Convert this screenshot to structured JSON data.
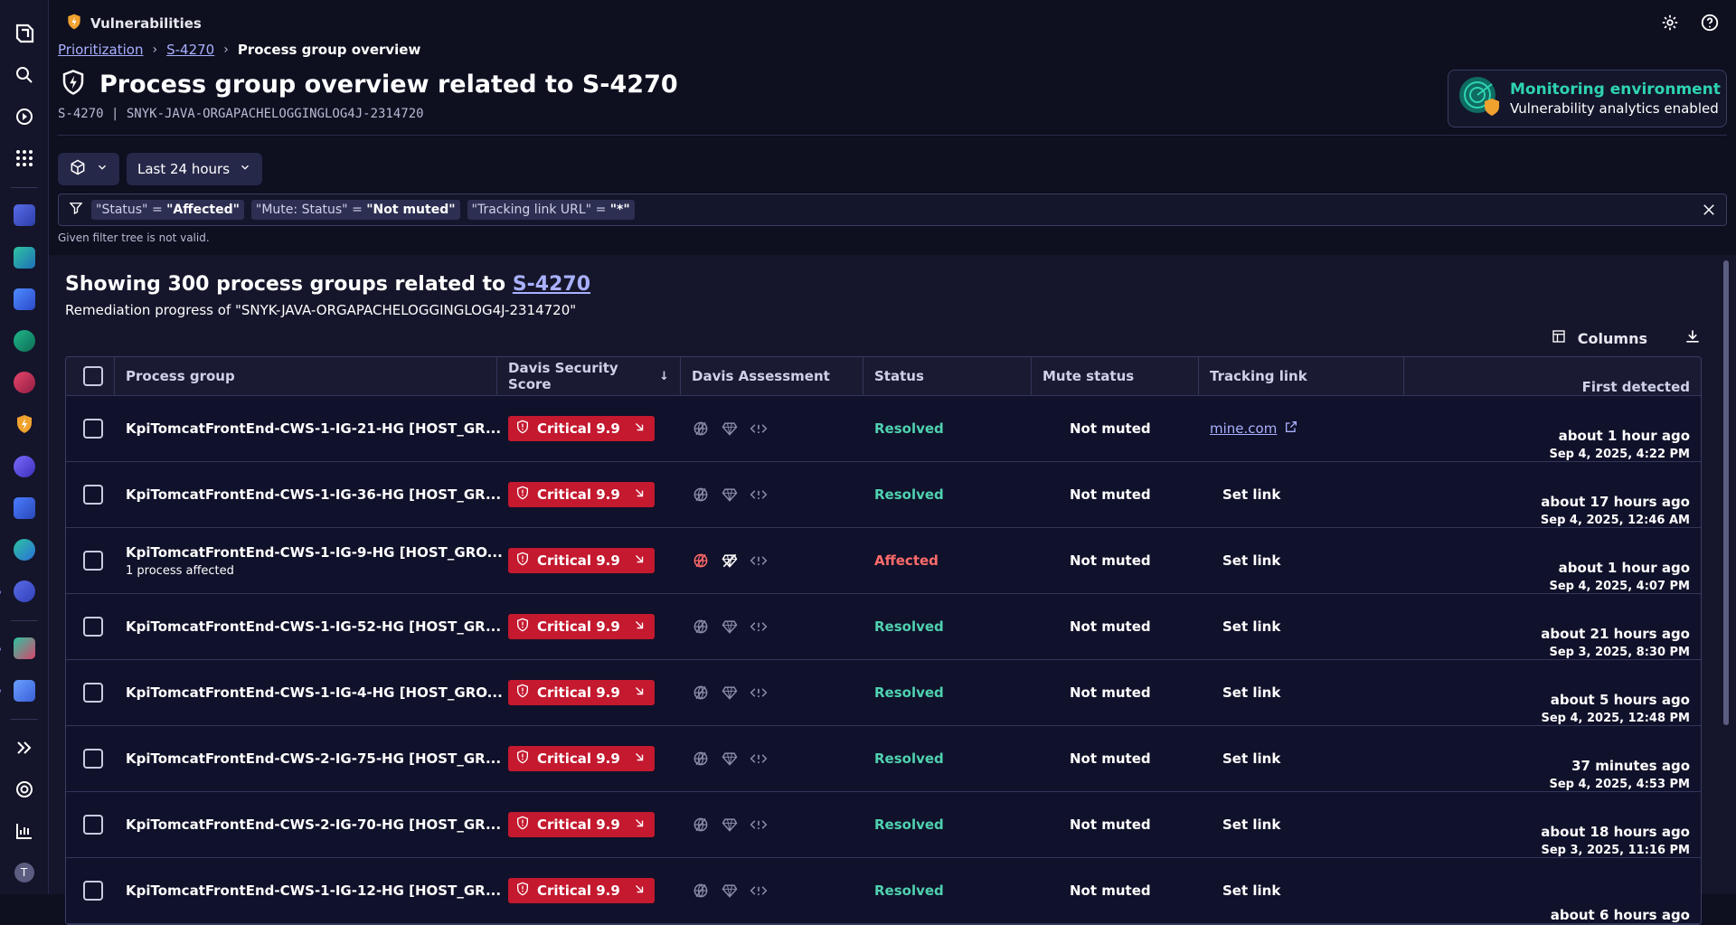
{
  "app": {
    "name": "Vulnerabilities",
    "icon": "lightning-shield-icon"
  },
  "breadcrumb": {
    "items": [
      "Prioritization",
      "S-4270"
    ],
    "current": "Process group overview"
  },
  "page": {
    "title": "Process group overview related to S-4270",
    "subtitle": "S-4270 | SNYK-JAVA-ORGAPACHELOGGINGLOG4J-2314720"
  },
  "monitor": {
    "title": "Monitoring environment",
    "subtitle": "Vulnerability analytics enabled"
  },
  "controls": {
    "timeframe": "Last 24 hours"
  },
  "filters": [
    {
      "key": "\"Status\" = ",
      "value": "\"Affected\""
    },
    {
      "key": "\"Mute: Status\" = ",
      "value": "\"Not muted\""
    },
    {
      "key": "\"Tracking link URL\" = ",
      "value": "\"*\""
    }
  ],
  "filter_error": "Given filter tree is not valid.",
  "results": {
    "showing_prefix": "Showing 300 process groups related to ",
    "showing_link": "S-4270",
    "remediation": "Remediation progress of \"SNYK-JAVA-ORGAPACHELOGGINGLOG4J-2314720\"",
    "columns_label": "Columns"
  },
  "table": {
    "headers": {
      "process_group": "Process group",
      "score": "Davis Security Score",
      "assessment": "Davis Assessment",
      "status": "Status",
      "mute": "Mute status",
      "tracking": "Tracking link",
      "first": "First detected"
    },
    "rows": [
      {
        "name": "KpiTomcatFrontEnd-CWS-1-IG-21-HG [HOST_GR...",
        "sub": "",
        "score": "Critical 9.9",
        "status": "Resolved",
        "mute": "Not muted",
        "link": "mine.com",
        "rel": "about 1 hour ago",
        "abs": "Sep 4, 2025, 4:22 PM"
      },
      {
        "name": "KpiTomcatFrontEnd-CWS-1-IG-36-HG [HOST_GR...",
        "sub": "",
        "score": "Critical 9.9",
        "status": "Resolved",
        "mute": "Not muted",
        "link": "Set link",
        "rel": "about 17 hours ago",
        "abs": "Sep 4, 2025, 12:46 AM"
      },
      {
        "name": "KpiTomcatFrontEnd-CWS-1-IG-9-HG [HOST_GRO...",
        "sub": "1 process affected",
        "score": "Critical 9.9",
        "status": "Affected",
        "mute": "Not muted",
        "link": "Set link",
        "rel": "about 1 hour ago",
        "abs": "Sep 4, 2025, 4:07 PM"
      },
      {
        "name": "KpiTomcatFrontEnd-CWS-1-IG-52-HG [HOST_GR...",
        "sub": "",
        "score": "Critical 9.9",
        "status": "Resolved",
        "mute": "Not muted",
        "link": "Set link",
        "rel": "about 21 hours ago",
        "abs": "Sep 3, 2025, 8:30 PM"
      },
      {
        "name": "KpiTomcatFrontEnd-CWS-1-IG-4-HG [HOST_GRO...",
        "sub": "",
        "score": "Critical 9.9",
        "status": "Resolved",
        "mute": "Not muted",
        "link": "Set link",
        "rel": "about 5 hours ago",
        "abs": "Sep 4, 2025, 12:48 PM"
      },
      {
        "name": "KpiTomcatFrontEnd-CWS-2-IG-75-HG [HOST_GR...",
        "sub": "",
        "score": "Critical 9.9",
        "status": "Resolved",
        "mute": "Not muted",
        "link": "Set link",
        "rel": "37 minutes ago",
        "abs": "Sep 4, 2025, 4:53 PM"
      },
      {
        "name": "KpiTomcatFrontEnd-CWS-2-IG-70-HG [HOST_GR...",
        "sub": "",
        "score": "Critical 9.9",
        "status": "Resolved",
        "mute": "Not muted",
        "link": "Set link",
        "rel": "about 18 hours ago",
        "abs": "Sep 3, 2025, 11:16 PM"
      },
      {
        "name": "KpiTomcatFrontEnd-CWS-1-IG-12-HG [HOST_GR...",
        "sub": "",
        "score": "Critical 9.9",
        "status": "Resolved",
        "mute": "Not muted",
        "link": "Set link",
        "rel": "about 6 hours ago",
        "abs": ""
      }
    ]
  },
  "sidebar": {
    "avatar_initial": "T"
  },
  "colors": {
    "accent": "#a9b0ff",
    "critical": "#c4192f",
    "resolved": "#4fd1b0",
    "affected": "#ff6b6b"
  }
}
